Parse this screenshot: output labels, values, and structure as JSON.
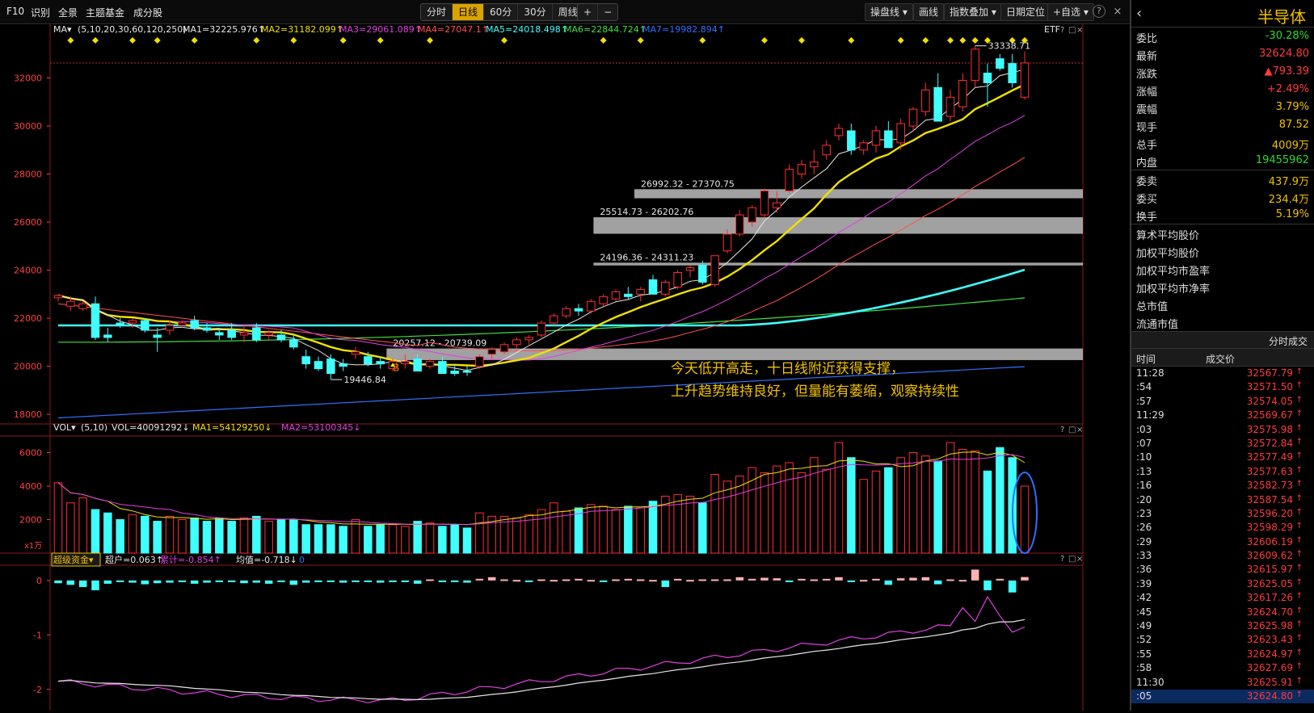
{
  "nav": {
    "f10": "F10",
    "identify": "识别",
    "overview": "全景",
    "theme_fund": "主题基金",
    "components": "成分股"
  },
  "periods": [
    "分时",
    "日线",
    "60分",
    "30分",
    "周线"
  ],
  "period_active": 1,
  "zoom_plus": "+",
  "zoom_minus": "−",
  "tools": {
    "panel_line": "操盘线",
    "draw": "画线",
    "index_overlay": "指数叠加",
    "date_locate": "日期定位",
    "watchlist": "+自选"
  },
  "help_icon": "?",
  "close_icon": "×",
  "etf_label": "ETF",
  "ma_legend": {
    "title": "MA",
    "params": "(5,10,20,30,60,120,250)",
    "items": [
      {
        "text": "MA1=32225.976↑",
        "color": "#e6e6e6"
      },
      {
        "text": "MA2=31182.099↑",
        "color": "#f0e000"
      },
      {
        "text": "MA3=29061.089↑",
        "color": "#e040e0"
      },
      {
        "text": "MA4=27047.1↑",
        "color": "#ff5050"
      },
      {
        "text": "MA5=24018.498↑",
        "color": "#40ffff"
      },
      {
        "text": "MA6=22844.724↑",
        "color": "#40e040"
      },
      {
        "text": "MA7=19982.894↑",
        "color": "#3070ff"
      }
    ]
  },
  "price_axis": [
    "32000",
    "30000",
    "28000",
    "26000",
    "24000",
    "22000",
    "20000",
    "18000"
  ],
  "annotations": {
    "high": "33338.71",
    "low": "19446.84",
    "zone1": "26992.32 - 27370.75",
    "zone2": "25514.73 - 26202.76",
    "zone3": "24196.36 - 24311.23",
    "zone4": "20257.12 - 20739.09",
    "buy_mark": "B",
    "comment1": "今天低开高走，十日线附近获得支撑，",
    "comment2": "上升趋势维持良好，但量能有萎缩，观察持续性"
  },
  "vol_legend": {
    "title": "VOL",
    "params": "(5,10)",
    "vol": "VOL=40091292↓",
    "ma1": "MA1=54129250↓",
    "ma2": "MA2=53100345↓"
  },
  "vol_axis": [
    "6000",
    "4000",
    "2000"
  ],
  "vol_unit": "x1万",
  "fund_legend": {
    "title": "超级资金",
    "super": "超户=0.063↑",
    "cum": "累计=-0.854↑",
    "avg": "均值=-0.718↓",
    "zero": "0"
  },
  "fund_axis": [
    "0",
    "-1",
    "-2"
  ],
  "panel_controls": {
    "help": "?",
    "restore": "□",
    "close": "×"
  },
  "sidebar": {
    "name": "半导体",
    "rows1": [
      {
        "label": "委比",
        "value": "-30.28%",
        "cls": "green"
      },
      {
        "label": "最新",
        "value": "32624.80",
        "cls": "red"
      },
      {
        "label": "涨跌",
        "value": "▲793.39",
        "cls": "red"
      },
      {
        "label": "涨幅",
        "value": "+2.49%",
        "cls": "red"
      },
      {
        "label": "震幅",
        "value": "3.79%",
        "cls": "yel"
      },
      {
        "label": "现手",
        "value": "87.52",
        "cls": "yel"
      },
      {
        "label": "总手",
        "value": "4009万",
        "cls": "yel"
      },
      {
        "label": "内盘",
        "value": "19455962",
        "cls": "green"
      }
    ],
    "rows2": [
      {
        "label": "委卖",
        "value": "437.9万",
        "cls": "yel"
      },
      {
        "label": "委买",
        "value": "234.4万",
        "cls": "yel"
      },
      {
        "label": "换手",
        "value": "5.19%",
        "cls": "yel"
      }
    ],
    "plain": [
      "算术平均股价",
      "加权平均股价",
      "加权平均市盈率",
      "加权平均市净率",
      "总市值",
      "流通市值"
    ],
    "ticks_title": "分时成交",
    "ticks_head": {
      "time": "时间",
      "price": "成交价"
    },
    "ticks": [
      {
        "t": "11:28",
        "p": "32567.79"
      },
      {
        "t": ":54",
        "p": "32571.50"
      },
      {
        "t": ":57",
        "p": "32574.05"
      },
      {
        "t": "11:29",
        "p": "32569.67"
      },
      {
        "t": ":03",
        "p": "32575.98"
      },
      {
        "t": ":07",
        "p": "32572.84"
      },
      {
        "t": ":10",
        "p": "32577.49"
      },
      {
        "t": ":13",
        "p": "32577.63"
      },
      {
        "t": ":16",
        "p": "32582.73"
      },
      {
        "t": ":20",
        "p": "32587.54"
      },
      {
        "t": ":23",
        "p": "32596.20"
      },
      {
        "t": ":26",
        "p": "32598.29"
      },
      {
        "t": ":29",
        "p": "32606.19"
      },
      {
        "t": ":33",
        "p": "32609.62"
      },
      {
        "t": ":36",
        "p": "32615.97"
      },
      {
        "t": ":39",
        "p": "32625.05"
      },
      {
        "t": ":42",
        "p": "32617.26"
      },
      {
        "t": ":45",
        "p": "32624.70"
      },
      {
        "t": ":49",
        "p": "32625.98"
      },
      {
        "t": ":52",
        "p": "32623.43"
      },
      {
        "t": ":55",
        "p": "32624.97"
      },
      {
        "t": ":58",
        "p": "32627.69"
      },
      {
        "t": "11:30",
        "p": "32625.91"
      },
      {
        "t": ":05",
        "p": "32624.80"
      }
    ]
  },
  "candles": [
    [
      22850,
      23000,
      22700,
      22950
    ],
    [
      22500,
      22900,
      22300,
      22700
    ],
    [
      22400,
      22700,
      22300,
      22600
    ],
    [
      22600,
      22900,
      21100,
      21200
    ],
    [
      21300,
      21600,
      21000,
      21200
    ],
    [
      21800,
      22000,
      21600,
      21700
    ],
    [
      21800,
      22000,
      21600,
      21900
    ],
    [
      21900,
      22000,
      21400,
      21500
    ],
    [
      21300,
      21600,
      20600,
      21200
    ],
    [
      21500,
      21900,
      21300,
      21700
    ],
    [
      21700,
      21900,
      21600,
      21800
    ],
    [
      21900,
      22100,
      21500,
      21600
    ],
    [
      21600,
      21800,
      21400,
      21500
    ],
    [
      21400,
      21600,
      21100,
      21300
    ],
    [
      21500,
      21800,
      21100,
      21200
    ],
    [
      21300,
      21700,
      21000,
      21400
    ],
    [
      21600,
      21800,
      21000,
      21100
    ],
    [
      21300,
      21500,
      21100,
      21400
    ],
    [
      21300,
      21500,
      21000,
      21100
    ],
    [
      21100,
      21300,
      20700,
      20800
    ],
    [
      20400,
      20700,
      19900,
      20100
    ],
    [
      20200,
      20400,
      19800,
      19900
    ],
    [
      20300,
      20500,
      19446,
      19700
    ],
    [
      20100,
      20300,
      19800,
      20000
    ],
    [
      20500,
      20800,
      20300,
      20600
    ],
    [
      20400,
      20600,
      20000,
      20100
    ],
    [
      20200,
      20400,
      19900,
      20100
    ],
    [
      19900,
      20300,
      19800,
      20200
    ],
    [
      20100,
      20500,
      19900,
      20200
    ],
    [
      20300,
      20500,
      19900,
      19800
    ],
    [
      20000,
      20300,
      19900,
      20200
    ],
    [
      20200,
      20400,
      19700,
      19700
    ],
    [
      19800,
      20100,
      19600,
      19700
    ],
    [
      19800,
      20000,
      19600,
      19750
    ],
    [
      20000,
      20500,
      19900,
      20400
    ],
    [
      20500,
      20800,
      20300,
      20700
    ],
    [
      20600,
      21000,
      20500,
      20900
    ],
    [
      20900,
      21200,
      20700,
      21100
    ],
    [
      21100,
      21300,
      20900,
      21200
    ],
    [
      21300,
      21900,
      21200,
      21800
    ],
    [
      21800,
      22200,
      21700,
      22100
    ],
    [
      22100,
      22500,
      22000,
      22400
    ],
    [
      22400,
      22600,
      22100,
      22300
    ],
    [
      22300,
      22800,
      22200,
      22700
    ],
    [
      22600,
      23000,
      22500,
      22900
    ],
    [
      22800,
      23200,
      22700,
      23100
    ],
    [
      23000,
      23300,
      22800,
      22900
    ],
    [
      23000,
      23300,
      22700,
      23200
    ],
    [
      23600,
      23800,
      23100,
      23000
    ],
    [
      23000,
      23600,
      22900,
      23500
    ],
    [
      23300,
      24000,
      23200,
      23900
    ],
    [
      24000,
      24200,
      23700,
      24100
    ],
    [
      24200,
      24400,
      23400,
      23500
    ],
    [
      23400,
      24600,
      23300,
      24600
    ],
    [
      24800,
      25700,
      24700,
      25500
    ],
    [
      25500,
      26500,
      25400,
      26300
    ],
    [
      26000,
      26700,
      25800,
      26600
    ],
    [
      26300,
      27400,
      26200,
      27300
    ],
    [
      26600,
      27300,
      26400,
      26800
    ],
    [
      27300,
      28400,
      27200,
      28200
    ],
    [
      28000,
      28600,
      27800,
      28400
    ],
    [
      28300,
      29000,
      28000,
      28500
    ],
    [
      28800,
      29400,
      28600,
      29200
    ],
    [
      29600,
      30100,
      29400,
      29900
    ],
    [
      29800,
      30100,
      28800,
      29000
    ],
    [
      29000,
      29400,
      28800,
      29300
    ],
    [
      29200,
      30000,
      28900,
      29800
    ],
    [
      29800,
      30200,
      29100,
      29100
    ],
    [
      29300,
      30300,
      29000,
      30100
    ],
    [
      30000,
      30800,
      29800,
      30700
    ],
    [
      30600,
      31800,
      30400,
      31500
    ],
    [
      31600,
      32200,
      30600,
      30200
    ],
    [
      30400,
      31500,
      30200,
      31200
    ],
    [
      30800,
      32200,
      30600,
      31900
    ],
    [
      31900,
      33338,
      31600,
      33200
    ],
    [
      32200,
      32600,
      30800,
      31800
    ],
    [
      32800,
      33000,
      32300,
      32400
    ],
    [
      32600,
      33000,
      31600,
      31800
    ],
    [
      31200,
      33100,
      31100,
      32624
    ]
  ],
  "vol": [
    4200,
    3000,
    3300,
    2600,
    2400,
    2000,
    2300,
    2200,
    1900,
    2200,
    2000,
    2100,
    1900,
    2100,
    1900,
    2100,
    2200,
    1900,
    2000,
    2000,
    1700,
    1700,
    1700,
    1600,
    2000,
    1600,
    1700,
    1700,
    1600,
    1900,
    1800,
    1600,
    1700,
    1500,
    2400,
    2200,
    2200,
    2100,
    2300,
    2600,
    3000,
    2500,
    2700,
    2900,
    2800,
    2600,
    2800,
    2700,
    3100,
    3400,
    3500,
    3400,
    3000,
    4700,
    4300,
    4600,
    5100,
    4800,
    5200,
    5400,
    4800,
    5700,
    5000,
    6600,
    5700,
    4400,
    4900,
    5100,
    5700,
    6000,
    5800,
    5500,
    6600,
    6200,
    6100,
    4900,
    6300,
    5700,
    4000
  ],
  "ma1_end": 32226,
  "ma2_end": 31182,
  "ma3_end": 29061,
  "ma4_end": 27047,
  "ma5_end": 24018,
  "ma6_end": 22845,
  "ma7_end": 19983
}
